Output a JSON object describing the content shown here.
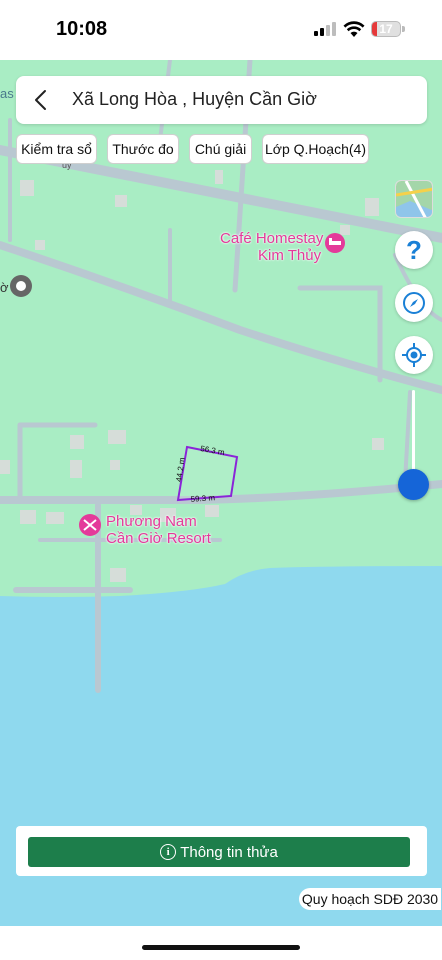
{
  "status_bar": {
    "time": "10:08",
    "battery_level": "17",
    "battery_color": "#e5393a"
  },
  "search": {
    "back_icon": "chevron-left-icon",
    "location_text": "Xã Long Hòa , Huyện Cần Giờ"
  },
  "toolbar": {
    "chips": [
      {
        "label": "Kiểm tra sổ"
      },
      {
        "label": "Thước đo"
      },
      {
        "label": "Chú giải"
      },
      {
        "label": "Lớp Q.Hoạch(4)"
      }
    ]
  },
  "map": {
    "land_color": "#a9edc4",
    "water_color": "#8fd9ee",
    "parcel_color": "#8a24d8",
    "place_labels": [
      {
        "line1": "Café Homestay",
        "line2": "Kim Thủy",
        "icon": "hotel-icon"
      },
      {
        "line1": "Phương Nam",
        "line2": "Cần Giờ Resort",
        "icon": "resort-icon"
      }
    ],
    "edge_text": {
      "top_left": "as",
      "left_marker": "ờ",
      "road_label": "uy"
    },
    "parcel_dimensions": {
      "top": "56.3 m",
      "left": "44.2 m",
      "bottom": "59.3 m"
    }
  },
  "controls": {
    "map_layers_icon": "map-thumbnail-icon",
    "help_label": "?",
    "compass_icon": "compass-icon",
    "locate_icon": "locate-icon",
    "zoom_level": 0.15
  },
  "bottom": {
    "info_button_label": "Thông tin thửa",
    "info_icon_glyph": "i",
    "plan_badge": "Quy hoạch SDĐ 2030"
  }
}
